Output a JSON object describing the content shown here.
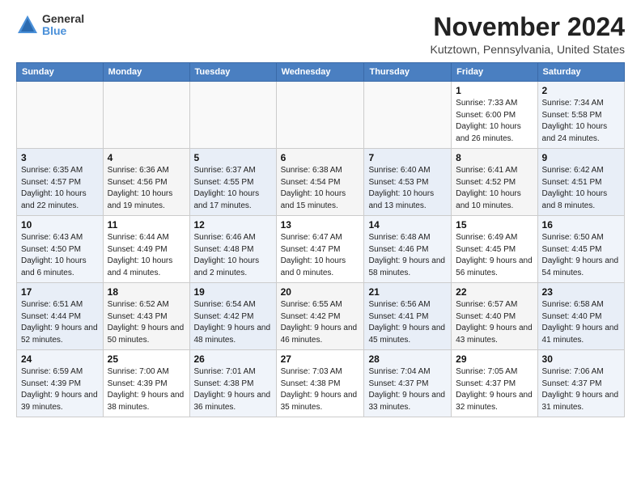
{
  "header": {
    "logo_line1": "General",
    "logo_line2": "Blue",
    "month_title": "November 2024",
    "location": "Kutztown, Pennsylvania, United States"
  },
  "calendar": {
    "headers": [
      "Sunday",
      "Monday",
      "Tuesday",
      "Wednesday",
      "Thursday",
      "Friday",
      "Saturday"
    ],
    "weeks": [
      [
        {
          "day": "",
          "info": ""
        },
        {
          "day": "",
          "info": ""
        },
        {
          "day": "",
          "info": ""
        },
        {
          "day": "",
          "info": ""
        },
        {
          "day": "",
          "info": ""
        },
        {
          "day": "1",
          "info": "Sunrise: 7:33 AM\nSunset: 6:00 PM\nDaylight: 10 hours and 26 minutes."
        },
        {
          "day": "2",
          "info": "Sunrise: 7:34 AM\nSunset: 5:58 PM\nDaylight: 10 hours and 24 minutes."
        }
      ],
      [
        {
          "day": "3",
          "info": "Sunrise: 6:35 AM\nSunset: 4:57 PM\nDaylight: 10 hours and 22 minutes."
        },
        {
          "day": "4",
          "info": "Sunrise: 6:36 AM\nSunset: 4:56 PM\nDaylight: 10 hours and 19 minutes."
        },
        {
          "day": "5",
          "info": "Sunrise: 6:37 AM\nSunset: 4:55 PM\nDaylight: 10 hours and 17 minutes."
        },
        {
          "day": "6",
          "info": "Sunrise: 6:38 AM\nSunset: 4:54 PM\nDaylight: 10 hours and 15 minutes."
        },
        {
          "day": "7",
          "info": "Sunrise: 6:40 AM\nSunset: 4:53 PM\nDaylight: 10 hours and 13 minutes."
        },
        {
          "day": "8",
          "info": "Sunrise: 6:41 AM\nSunset: 4:52 PM\nDaylight: 10 hours and 10 minutes."
        },
        {
          "day": "9",
          "info": "Sunrise: 6:42 AM\nSunset: 4:51 PM\nDaylight: 10 hours and 8 minutes."
        }
      ],
      [
        {
          "day": "10",
          "info": "Sunrise: 6:43 AM\nSunset: 4:50 PM\nDaylight: 10 hours and 6 minutes."
        },
        {
          "day": "11",
          "info": "Sunrise: 6:44 AM\nSunset: 4:49 PM\nDaylight: 10 hours and 4 minutes."
        },
        {
          "day": "12",
          "info": "Sunrise: 6:46 AM\nSunset: 4:48 PM\nDaylight: 10 hours and 2 minutes."
        },
        {
          "day": "13",
          "info": "Sunrise: 6:47 AM\nSunset: 4:47 PM\nDaylight: 10 hours and 0 minutes."
        },
        {
          "day": "14",
          "info": "Sunrise: 6:48 AM\nSunset: 4:46 PM\nDaylight: 9 hours and 58 minutes."
        },
        {
          "day": "15",
          "info": "Sunrise: 6:49 AM\nSunset: 4:45 PM\nDaylight: 9 hours and 56 minutes."
        },
        {
          "day": "16",
          "info": "Sunrise: 6:50 AM\nSunset: 4:45 PM\nDaylight: 9 hours and 54 minutes."
        }
      ],
      [
        {
          "day": "17",
          "info": "Sunrise: 6:51 AM\nSunset: 4:44 PM\nDaylight: 9 hours and 52 minutes."
        },
        {
          "day": "18",
          "info": "Sunrise: 6:52 AM\nSunset: 4:43 PM\nDaylight: 9 hours and 50 minutes."
        },
        {
          "day": "19",
          "info": "Sunrise: 6:54 AM\nSunset: 4:42 PM\nDaylight: 9 hours and 48 minutes."
        },
        {
          "day": "20",
          "info": "Sunrise: 6:55 AM\nSunset: 4:42 PM\nDaylight: 9 hours and 46 minutes."
        },
        {
          "day": "21",
          "info": "Sunrise: 6:56 AM\nSunset: 4:41 PM\nDaylight: 9 hours and 45 minutes."
        },
        {
          "day": "22",
          "info": "Sunrise: 6:57 AM\nSunset: 4:40 PM\nDaylight: 9 hours and 43 minutes."
        },
        {
          "day": "23",
          "info": "Sunrise: 6:58 AM\nSunset: 4:40 PM\nDaylight: 9 hours and 41 minutes."
        }
      ],
      [
        {
          "day": "24",
          "info": "Sunrise: 6:59 AM\nSunset: 4:39 PM\nDaylight: 9 hours and 39 minutes."
        },
        {
          "day": "25",
          "info": "Sunrise: 7:00 AM\nSunset: 4:39 PM\nDaylight: 9 hours and 38 minutes."
        },
        {
          "day": "26",
          "info": "Sunrise: 7:01 AM\nSunset: 4:38 PM\nDaylight: 9 hours and 36 minutes."
        },
        {
          "day": "27",
          "info": "Sunrise: 7:03 AM\nSunset: 4:38 PM\nDaylight: 9 hours and 35 minutes."
        },
        {
          "day": "28",
          "info": "Sunrise: 7:04 AM\nSunset: 4:37 PM\nDaylight: 9 hours and 33 minutes."
        },
        {
          "day": "29",
          "info": "Sunrise: 7:05 AM\nSunset: 4:37 PM\nDaylight: 9 hours and 32 minutes."
        },
        {
          "day": "30",
          "info": "Sunrise: 7:06 AM\nSunset: 4:37 PM\nDaylight: 9 hours and 31 minutes."
        }
      ]
    ]
  }
}
